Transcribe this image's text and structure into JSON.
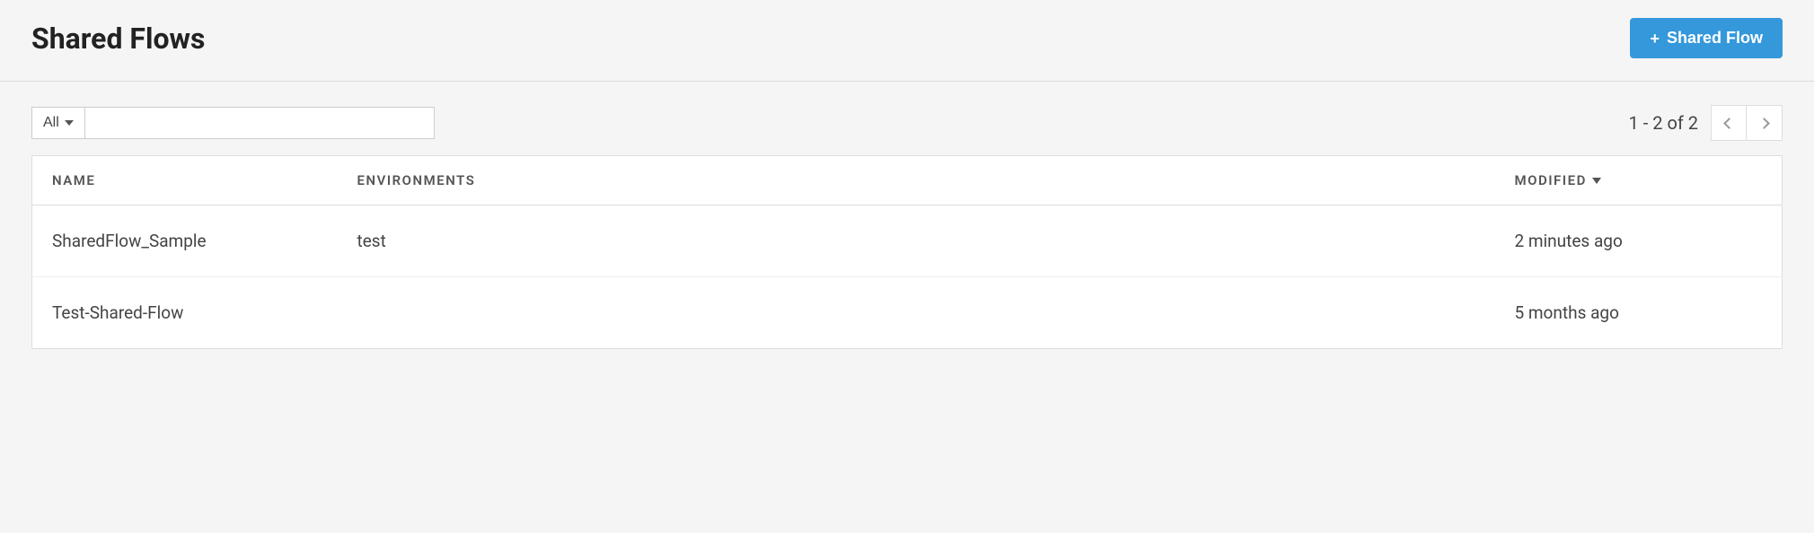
{
  "header": {
    "title": "Shared Flows",
    "add_button_label": "Shared Flow"
  },
  "toolbar": {
    "filter_label": "All",
    "search_value": ""
  },
  "pagination": {
    "text": "1 - 2 of 2"
  },
  "table": {
    "columns": {
      "name": "NAME",
      "environments": "ENVIRONMENTS",
      "modified": "MODIFIED"
    },
    "rows": [
      {
        "name": "SharedFlow_Sample",
        "environments": "test",
        "modified": "2 minutes ago"
      },
      {
        "name": "Test-Shared-Flow",
        "environments": "",
        "modified": "5 months ago"
      }
    ]
  }
}
